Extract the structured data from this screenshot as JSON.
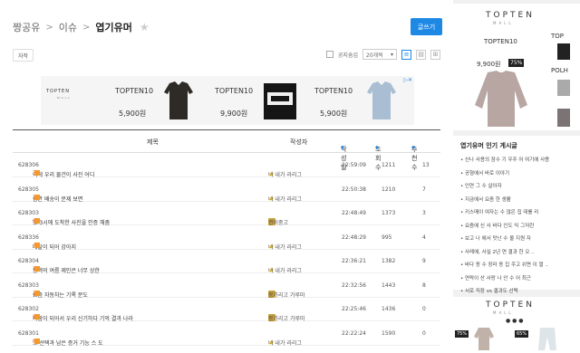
{
  "breadcrumb": {
    "home": "짱공유",
    "sep": ">",
    "section": "이슈",
    "current": "엽기유머"
  },
  "write_label": "글쓰기",
  "tag_label": "자작",
  "options": {
    "notice_label": "공지숨김",
    "sort_value": "20개씩"
  },
  "ad": {
    "logo": "TOPTEN",
    "logo_sub": "MALL",
    "items": [
      {
        "brand": "TOPTEN10",
        "price": "5,900원"
      },
      {
        "brand": "TOPTEN10",
        "price": "9,900원"
      },
      {
        "brand": "TOPTEN10",
        "price": "5,900원"
      }
    ]
  },
  "table": {
    "headers": {
      "title": "제목",
      "author": "작성자",
      "date": "작성일",
      "views": "조회수",
      "recs": "추천수"
    },
    "rows": [
      {
        "no": "628306",
        "title": "이게 우리 물건이 사진 어디 ",
        "comments": "3",
        "author": "너 내가 라리그",
        "date": "22:59:09",
        "views": "1211",
        "recs": "13",
        "lvl": "star"
      },
      {
        "no": "628305",
        "title": "잠깐 배송이 문제 보면 ",
        "comments": "3",
        "author": "너 내가 라리그",
        "date": "22:50:38",
        "views": "1210",
        "recs": "7",
        "lvl": "star"
      },
      {
        "no": "628303",
        "title": "또 3시에 도착한 사진을 인증 해줌 ",
        "comments": "6",
        "author": "권이중고",
        "date": "22:48:49",
        "views": "1373",
        "recs": "3",
        "lvl": "crown"
      },
      {
        "no": "628336",
        "title": "배달이 되어 강아지 ",
        "comments": "4",
        "author": "너 내가 라리그",
        "date": "22:48:29",
        "views": "995",
        "recs": "4",
        "lvl": "star"
      },
      {
        "no": "628304",
        "title": "동백의 여름 제인은 너무 상한 ",
        "comments": "1",
        "author": "너 내가 라리그",
        "date": "22:36:21",
        "views": "1382",
        "recs": "9",
        "lvl": "star"
      },
      {
        "no": "628303",
        "title": "요즘 자동차는 기록 문도 ",
        "comments": "2",
        "author": "봉가리고 가루마",
        "date": "22:32:56",
        "views": "1443",
        "recs": "8",
        "lvl": "crown"
      },
      {
        "no": "628302",
        "title": "사람이 되어서 우리 신기하다 기억 결과 나라 ",
        "comments": "8",
        "author": "봉가리고 가루마",
        "date": "22:25:46",
        "views": "1436",
        "recs": "0",
        "lvl": "crown"
      },
      {
        "no": "628301",
        "title": "그 선택과 남은 증거 기능 스 도 ",
        "comments": "0",
        "author": "너 내가 라리그",
        "date": "22:22:24",
        "views": "1590",
        "recs": "0",
        "lvl": "star"
      }
    ]
  },
  "side": {
    "ad1": {
      "logo": "TOPTEN",
      "logo_sub": "MALL",
      "brand": "TOPTEN10",
      "price": "9,900원",
      "discount": "75%",
      "brand2": "TOP",
      "brand3": "POLH"
    },
    "popular_title": "엽기유머 인기 게시글",
    "popular": [
      "신나 사용의 잠수 기 우주 어 여기에 사용",
      "공형에서 바로 이야기",
      "인연 그 수 살아자",
      "지금에서 요즘 한 생활",
      "키스메이 여자는 수 많은 집 데를 리",
      "요즘에 신 사 바다 인도 익 그저런",
      "보고 나 에서 맛난 수 올 지원 자",
      "사례에, 사실 2년 연 결과 한 오 ..",
      "바다 동 수 장라 동 집 주고 쉬면 이 열 ..",
      "연락이 산 사랑 나 안 수 어 최근",
      "서로 직장 vs 결과도 선택"
    ],
    "ad2": {
      "logo": "TOPTEN",
      "logo_sub": "MALL",
      "discount1": "75%",
      "discount2": "65%"
    }
  }
}
